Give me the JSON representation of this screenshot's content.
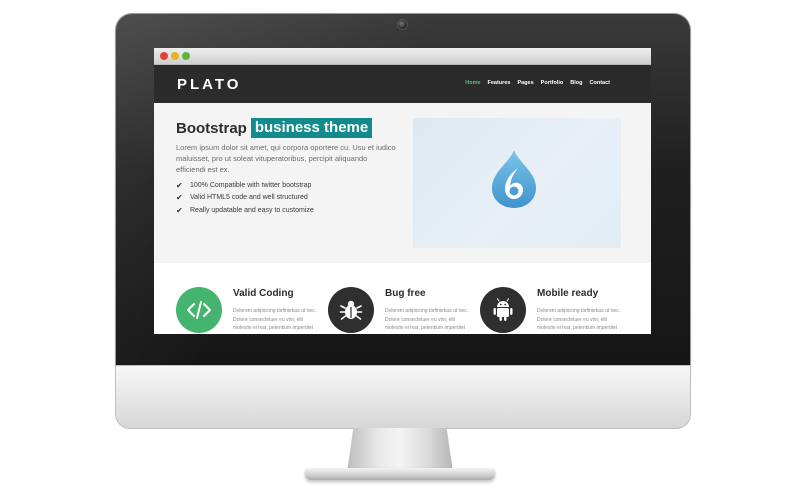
{
  "browser": {
    "traffic_lights": [
      "close",
      "minimize",
      "maximize"
    ]
  },
  "site": {
    "logo": "PLATO",
    "menu": [
      "Home",
      "Features",
      "Pages",
      "Portfolio",
      "Blog",
      "Contact"
    ],
    "active_menu": "Home",
    "colors": {
      "accent": "#5bbf87",
      "tag_bg": "#138a8c",
      "nav_bg": "#2b2b2b"
    }
  },
  "hero": {
    "headline_plain": "Bootstrap",
    "headline_highlight": "business theme",
    "lead": "Lorem ipsum dolor sit amet, qui corpora oportere cu. Usu et iudico maluisset, pro ut soleat vituperatoribus, percipit aliquando efficiendi est ex.",
    "features": [
      "100% Compatible with twitter bootstrap",
      "Valid HTML5 code and well structured",
      "Really updatable and easy to customize"
    ],
    "image_icon": "drupal-drop-icon"
  },
  "services": [
    {
      "title": "Valid Coding",
      "icon": "code-icon",
      "text": "Dolorem adipiscing definiebas ut nec. Dolore consectetuer eu vim, elit molestie ei has, petentium imperdiet"
    },
    {
      "title": "Bug free",
      "icon": "bug-icon",
      "text": "Dolorem adipiscing definiebas ut nec. Dolore consectetuer eu vim, elit molestie ei has, petentium imperdiet"
    },
    {
      "title": "Mobile ready",
      "icon": "android-icon",
      "text": "Dolorem adipiscing definiebas ut nec. Dolore consectetuer eu vim, elit molestie ei has, petentium imperdiet"
    }
  ]
}
